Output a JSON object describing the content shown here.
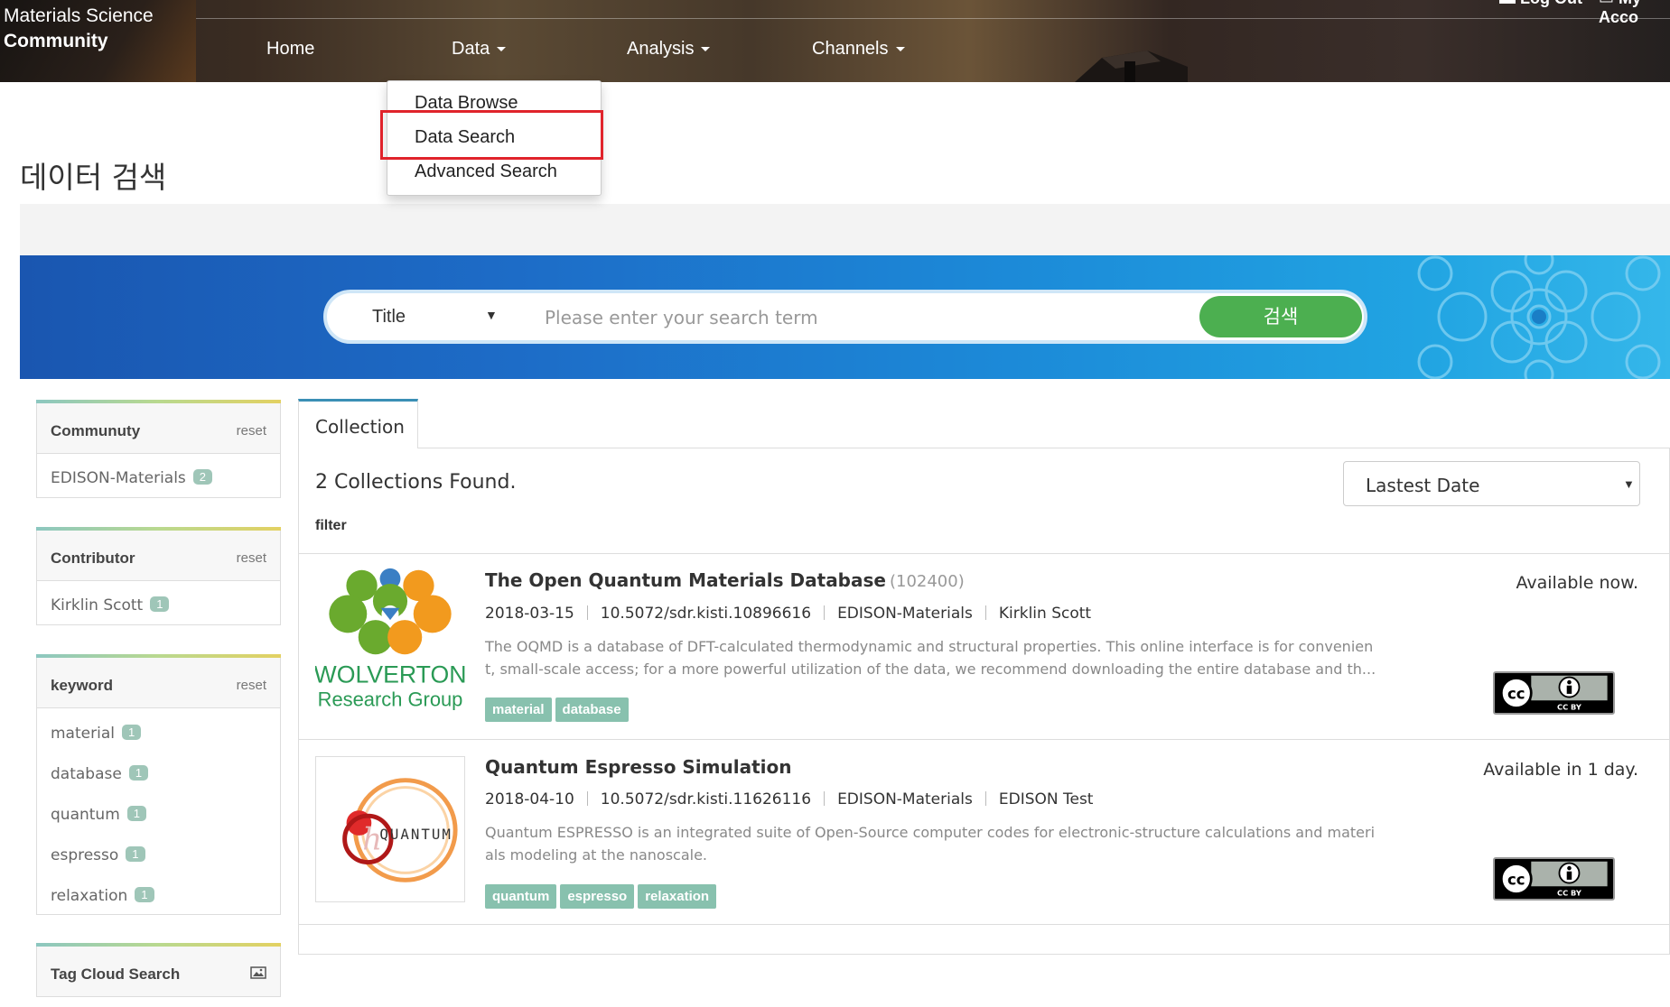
{
  "header": {
    "site_title_line1": "Materials Science",
    "site_title_line2": "Community",
    "util_logout": "Log Out",
    "util_myaccount": "My Acco",
    "nav": {
      "home": "Home",
      "data": "Data",
      "analysis": "Analysis",
      "channels": "Channels"
    }
  },
  "dropdown": {
    "items": [
      "Data Browse",
      "Data Search",
      "Advanced Search"
    ],
    "highlighted": "Data Search",
    "highlight_color": "#e0232b"
  },
  "page": {
    "title": "데이터 검색"
  },
  "search": {
    "field": "Title",
    "placeholder": "Please enter your search term",
    "button": "검색",
    "button_color": "#4caf50"
  },
  "sidebar": {
    "community": {
      "title": "Communuty",
      "reset": "reset",
      "items": [
        {
          "label": "EDISON-Materials",
          "count": "2"
        }
      ]
    },
    "contributor": {
      "title": "Contributor",
      "reset": "reset",
      "items": [
        {
          "label": "Kirklin Scott",
          "count": "1"
        }
      ]
    },
    "keyword": {
      "title": "keyword",
      "reset": "reset",
      "items": [
        {
          "label": "material",
          "count": "1"
        },
        {
          "label": "database",
          "count": "1"
        },
        {
          "label": "quantum",
          "count": "1"
        },
        {
          "label": "espresso",
          "count": "1"
        },
        {
          "label": "relaxation",
          "count": "1"
        }
      ]
    },
    "tagcloud": {
      "title": "Tag Cloud Search",
      "icon": "image-icon"
    }
  },
  "main": {
    "tab": "Collection",
    "found": "2 Collections Found.",
    "filter_label": "filter",
    "sort": "Lastest Date",
    "results": [
      {
        "thumb_line1": "WOLVERTON",
        "thumb_line2": "Research Group",
        "title": "The Open Quantum Materials Database",
        "count": "(102400)",
        "date": "2018-03-15",
        "doi": "10.5072/sdr.kisti.10896616",
        "community": "EDISON-Materials",
        "author": "Kirklin Scott",
        "desc_line1": "The OQMD is a database of DFT-calculated thermodynamic and structural properties. This online interface is for convenien",
        "desc_line2": "t, small-scale access; for a more powerful utilization of the data, we recommend downloading the entire database and th...",
        "tags": [
          "material",
          "database"
        ],
        "availability": "Available now.",
        "license": "CC BY"
      },
      {
        "thumb_text": "QUANTUM",
        "title": "Quantum Espresso Simulation",
        "date": "2018-04-10",
        "doi": "10.5072/sdr.kisti.11626116",
        "community": "EDISON-Materials",
        "author": "EDISON Test",
        "desc_line1": "Quantum ESPRESSO is an integrated suite of Open-Source computer codes for electronic-structure calculations and materi",
        "desc_line2": "als modeling at the nanoscale.",
        "tags": [
          "quantum",
          "espresso",
          "relaxation"
        ],
        "availability": "Available in 1 day.",
        "license": "CC BY"
      }
    ]
  }
}
